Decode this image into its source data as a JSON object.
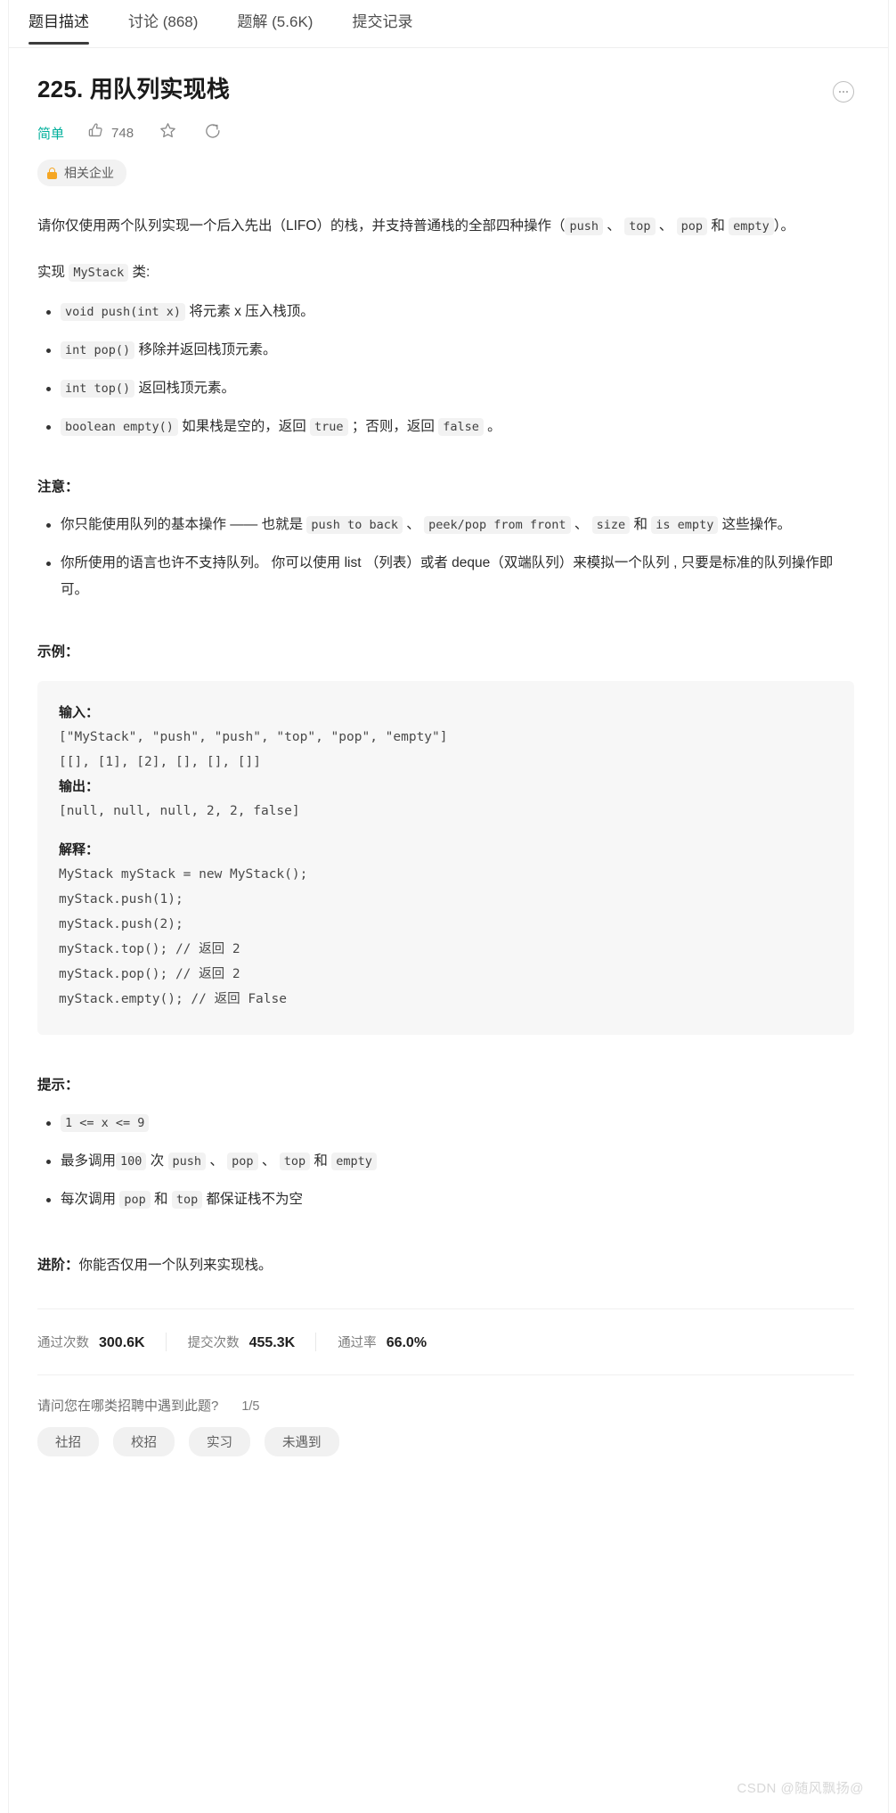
{
  "tabs": [
    {
      "label": "题目描述",
      "active": true
    },
    {
      "label": "讨论 (868)",
      "active": false
    },
    {
      "label": "题解 (5.6K)",
      "active": false
    },
    {
      "label": "提交记录",
      "active": false
    }
  ],
  "problem": {
    "title": "225. 用队列实现栈",
    "difficulty": "简单",
    "likes": "748",
    "company_badge": "相关企业",
    "intro_parts": [
      {
        "t": "text",
        "v": "请你仅使用两个队列实现一个后入先出（LIFO）的栈，并支持普通栈的全部四种操作（"
      },
      {
        "t": "code",
        "v": "push"
      },
      {
        "t": "text",
        "v": " 、 "
      },
      {
        "t": "code",
        "v": "top"
      },
      {
        "t": "text",
        "v": " 、 "
      },
      {
        "t": "code",
        "v": "pop"
      },
      {
        "t": "text",
        "v": " 和 "
      },
      {
        "t": "code",
        "v": "empty"
      },
      {
        "t": "text",
        "v": "）。"
      }
    ],
    "implement_parts": [
      {
        "t": "text",
        "v": "实现 "
      },
      {
        "t": "code",
        "v": "MyStack"
      },
      {
        "t": "text",
        "v": " 类:"
      }
    ],
    "methods": [
      [
        {
          "t": "code",
          "v": "void push(int x)"
        },
        {
          "t": "text",
          "v": " 将元素 x 压入栈顶。"
        }
      ],
      [
        {
          "t": "code",
          "v": "int pop()"
        },
        {
          "t": "text",
          "v": " 移除并返回栈顶元素。"
        }
      ],
      [
        {
          "t": "code",
          "v": "int top()"
        },
        {
          "t": "text",
          "v": " 返回栈顶元素。"
        }
      ],
      [
        {
          "t": "code",
          "v": "boolean empty()"
        },
        {
          "t": "text",
          "v": " 如果栈是空的，返回 "
        },
        {
          "t": "code",
          "v": "true"
        },
        {
          "t": "text",
          "v": " ；否则，返回 "
        },
        {
          "t": "code",
          "v": "false"
        },
        {
          "t": "text",
          "v": " 。"
        }
      ]
    ],
    "notes_heading": "注意：",
    "notes": [
      [
        {
          "t": "text",
          "v": "你只能使用队列的基本操作 —— 也就是 "
        },
        {
          "t": "code",
          "v": "push to back"
        },
        {
          "t": "text",
          "v": " 、 "
        },
        {
          "t": "code",
          "v": "peek/pop from front"
        },
        {
          "t": "text",
          "v": " 、 "
        },
        {
          "t": "code",
          "v": "size"
        },
        {
          "t": "text",
          "v": " 和 "
        },
        {
          "t": "code",
          "v": "is empty"
        },
        {
          "t": "text",
          "v": " 这些操作。"
        }
      ],
      [
        {
          "t": "text",
          "v": "你所使用的语言也许不支持队列。 你可以使用 list （列表）或者 deque（双端队列）来模拟一个队列 , 只要是标准的队列操作即可。"
        }
      ]
    ],
    "example_heading": "示例：",
    "example": {
      "input_label": "输入：",
      "input_lines": [
        "[\"MyStack\", \"push\", \"push\", \"top\", \"pop\", \"empty\"]",
        "[[], [1], [2], [], [], []]"
      ],
      "output_label": "输出：",
      "output_lines": [
        "[null, null, null, 2, 2, false]"
      ],
      "explain_label": "解释：",
      "explain_lines": [
        "MyStack myStack = new MyStack();",
        "myStack.push(1);",
        "myStack.push(2);",
        "myStack.top(); // 返回 2",
        "myStack.pop(); // 返回 2",
        "myStack.empty(); // 返回 False"
      ]
    },
    "hints_heading": "提示：",
    "hints": [
      [
        {
          "t": "code",
          "v": "1 <= x <= 9"
        }
      ],
      [
        {
          "t": "text",
          "v": "最多调用"
        },
        {
          "t": "code",
          "v": "100"
        },
        {
          "t": "text",
          "v": " 次 "
        },
        {
          "t": "code",
          "v": "push"
        },
        {
          "t": "text",
          "v": " 、 "
        },
        {
          "t": "code",
          "v": "pop"
        },
        {
          "t": "text",
          "v": " 、 "
        },
        {
          "t": "code",
          "v": "top"
        },
        {
          "t": "text",
          "v": " 和 "
        },
        {
          "t": "code",
          "v": "empty"
        }
      ],
      [
        {
          "t": "text",
          "v": "每次调用 "
        },
        {
          "t": "code",
          "v": "pop"
        },
        {
          "t": "text",
          "v": " 和 "
        },
        {
          "t": "code",
          "v": "top"
        },
        {
          "t": "text",
          "v": " 都保证栈不为空"
        }
      ]
    ],
    "advanced_label": "进阶：",
    "advanced_text": "你能否仅用一个队列来实现栈。"
  },
  "stats": [
    {
      "key": "通过次数",
      "value": "300.6K"
    },
    {
      "key": "提交次数",
      "value": "455.3K"
    },
    {
      "key": "通过率",
      "value": "66.0%"
    }
  ],
  "poll": {
    "question": "请问您在哪类招聘中遇到此题?",
    "index": "1/5",
    "chips": [
      "社招",
      "校招",
      "实习",
      "未遇到"
    ]
  },
  "watermark": "CSDN @随风飘扬@",
  "colors": {
    "difficulty_green": "#00af9b",
    "lock_orange": "#f5a623",
    "code_bg": "#f2f2f2",
    "example_bg": "#f7f7f7"
  }
}
